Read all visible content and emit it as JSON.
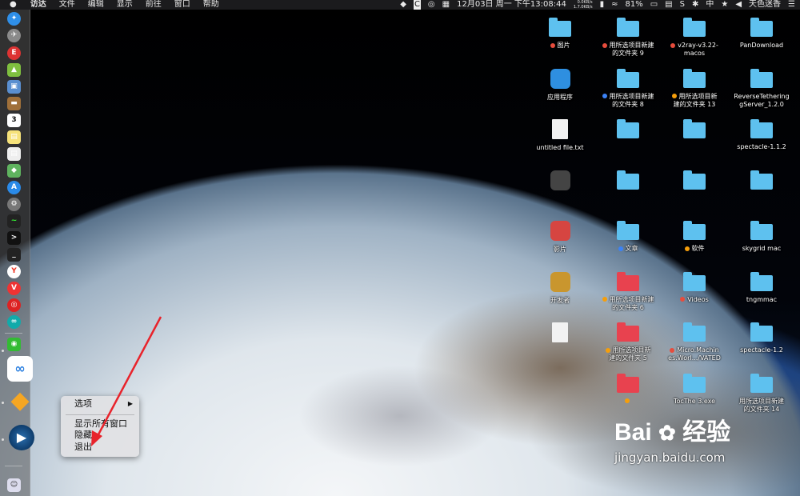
{
  "menubar": {
    "apple_glyph": "",
    "app_menus": [
      "访达",
      "文件",
      "编辑",
      "显示",
      "前往",
      "窗口",
      "帮助"
    ],
    "netspeed_top": "0.0KB/s",
    "netspeed_bottom": "1.7.0KB/s",
    "clock": "12月03日 周一 下午13:08:44",
    "battery": "81%",
    "input_method": "中",
    "user": "天色迷香"
  },
  "dock": {
    "icons": [
      "safari-icon",
      "launchpad-icon",
      "flashcard-icon",
      "android-icon",
      "preview-icon",
      "notebook-icon",
      "calendar-icon",
      "notes-icon",
      "maps-icon",
      "appstore-icon",
      "system-prefs-icon",
      "activity-monitor-icon",
      "terminal-icon",
      "yandex-icon",
      "vivaldi-icon",
      "netease-music-icon",
      "link-icon",
      "wechat-icon",
      "baidu-netdisk-icon",
      "sketch-icon",
      "quicktime-player-icon",
      "finder-icon"
    ]
  },
  "context_menu": {
    "items": [
      "选项",
      "显示所有窗口",
      "隐藏",
      "退出"
    ],
    "submenu_arrow": "▶"
  },
  "desktop": {
    "items": [
      {
        "type": "folder",
        "color": "#5ec1ef",
        "tag": "#e74c3c",
        "label1": "图片",
        "label2": ""
      },
      {
        "type": "folder",
        "color": "#5ec1ef",
        "tag": "#e74c3c",
        "label1": "用所选项目新建",
        "label2": "的文件夹 9"
      },
      {
        "type": "folder",
        "color": "#5ec1ef",
        "tag": "#e74c3c",
        "label1": "v2ray-v3.22-",
        "label2": "macos"
      },
      {
        "type": "folder",
        "color": "#5ec1ef",
        "tag": "",
        "label1": "PanDownload",
        "label2": ""
      },
      {
        "type": "app",
        "color": "#2e8fe0",
        "tag": "",
        "label1": "应用程序",
        "label2": ""
      },
      {
        "type": "folder",
        "color": "#5ec1ef",
        "tag": "#3b82f6",
        "label1": "用所选项目新建",
        "label2": "的文件夹 8"
      },
      {
        "type": "folder",
        "color": "#5ec1ef",
        "tag": "#f59e0b",
        "label1": "用所选项目新",
        "label2": "建的文件夹 13"
      },
      {
        "type": "folder",
        "color": "#5ec1ef",
        "tag": "",
        "label1": "ReverseTethering",
        "label2": "gServer_1.2.0"
      },
      {
        "type": "doc",
        "color": "#f2f2f2",
        "tag": "",
        "label1": "untitled file.txt",
        "label2": ""
      },
      {
        "type": "folder",
        "color": "#5ec1ef",
        "tag": "",
        "label1": "",
        "label2": ""
      },
      {
        "type": "folder",
        "color": "#5ec1ef",
        "tag": "",
        "label1": "",
        "label2": ""
      },
      {
        "type": "folder",
        "color": "#5ec1ef",
        "tag": "",
        "label1": "spectacle-1.1.2",
        "label2": ""
      },
      {
        "type": "app",
        "color": "#444",
        "tag": "",
        "label1": "",
        "label2": ""
      },
      {
        "type": "folder",
        "color": "#5ec1ef",
        "tag": "",
        "label1": "",
        "label2": ""
      },
      {
        "type": "folder",
        "color": "#5ec1ef",
        "tag": "",
        "label1": "",
        "label2": ""
      },
      {
        "type": "folder",
        "color": "#5ec1ef",
        "tag": "",
        "label1": "",
        "label2": ""
      },
      {
        "type": "app",
        "color": "#d64541",
        "tag": "",
        "label1": "影片",
        "label2": ""
      },
      {
        "type": "folder",
        "color": "#5ec1ef",
        "tag": "#3b82f6",
        "label1": "文章",
        "label2": ""
      },
      {
        "type": "folder",
        "color": "#5ec1ef",
        "tag": "#f59e0b",
        "label1": "软件",
        "label2": ""
      },
      {
        "type": "folder",
        "color": "#5ec1ef",
        "tag": "",
        "label1": "skygrid mac",
        "label2": ""
      },
      {
        "type": "app",
        "color": "#c9962e",
        "tag": "",
        "label1": "开发者",
        "label2": ""
      },
      {
        "type": "folder",
        "color": "#e8424f",
        "tag": "#f59e0b",
        "label1": "用所选项目新建",
        "label2": "的文件夹 6"
      },
      {
        "type": "folder",
        "color": "#5ec1ef",
        "tag": "#e74c3c",
        "label1": "Videos",
        "label2": ""
      },
      {
        "type": "folder",
        "color": "#5ec1ef",
        "tag": "",
        "label1": "tngmmac",
        "label2": ""
      },
      {
        "type": "doc",
        "color": "#f2f2f2",
        "tag": "",
        "label1": "",
        "label2": ""
      },
      {
        "type": "folder",
        "color": "#e8424f",
        "tag": "#f59e0b",
        "label1": "用所选项目新",
        "label2": "建的文件夹 5"
      },
      {
        "type": "folder",
        "color": "#5ec1ef",
        "tag": "#e74c3c",
        "label1": "Micro.Machin",
        "label2": "es.Worl.../VATED"
      },
      {
        "type": "folder",
        "color": "#5ec1ef",
        "tag": "",
        "label1": "spectacle-1.2",
        "label2": ""
      },
      {
        "type": "none",
        "color": "",
        "tag": "",
        "label1": "",
        "label2": ""
      },
      {
        "type": "folder",
        "color": "#e8424f",
        "tag": "#f59e0b",
        "label1": "",
        "label2": ""
      },
      {
        "type": "folder",
        "color": "#5ec1ef",
        "tag": "",
        "label1": "TocThe 3.exe",
        "label2": ""
      },
      {
        "type": "folder",
        "color": "#5ec1ef",
        "tag": "",
        "label1": "用所选项目新建",
        "label2": "的文件夹 14"
      }
    ]
  },
  "watermark": {
    "logo_text": "Bai",
    "logo_suffix": "经验",
    "url": "jingyan.baidu.com"
  }
}
